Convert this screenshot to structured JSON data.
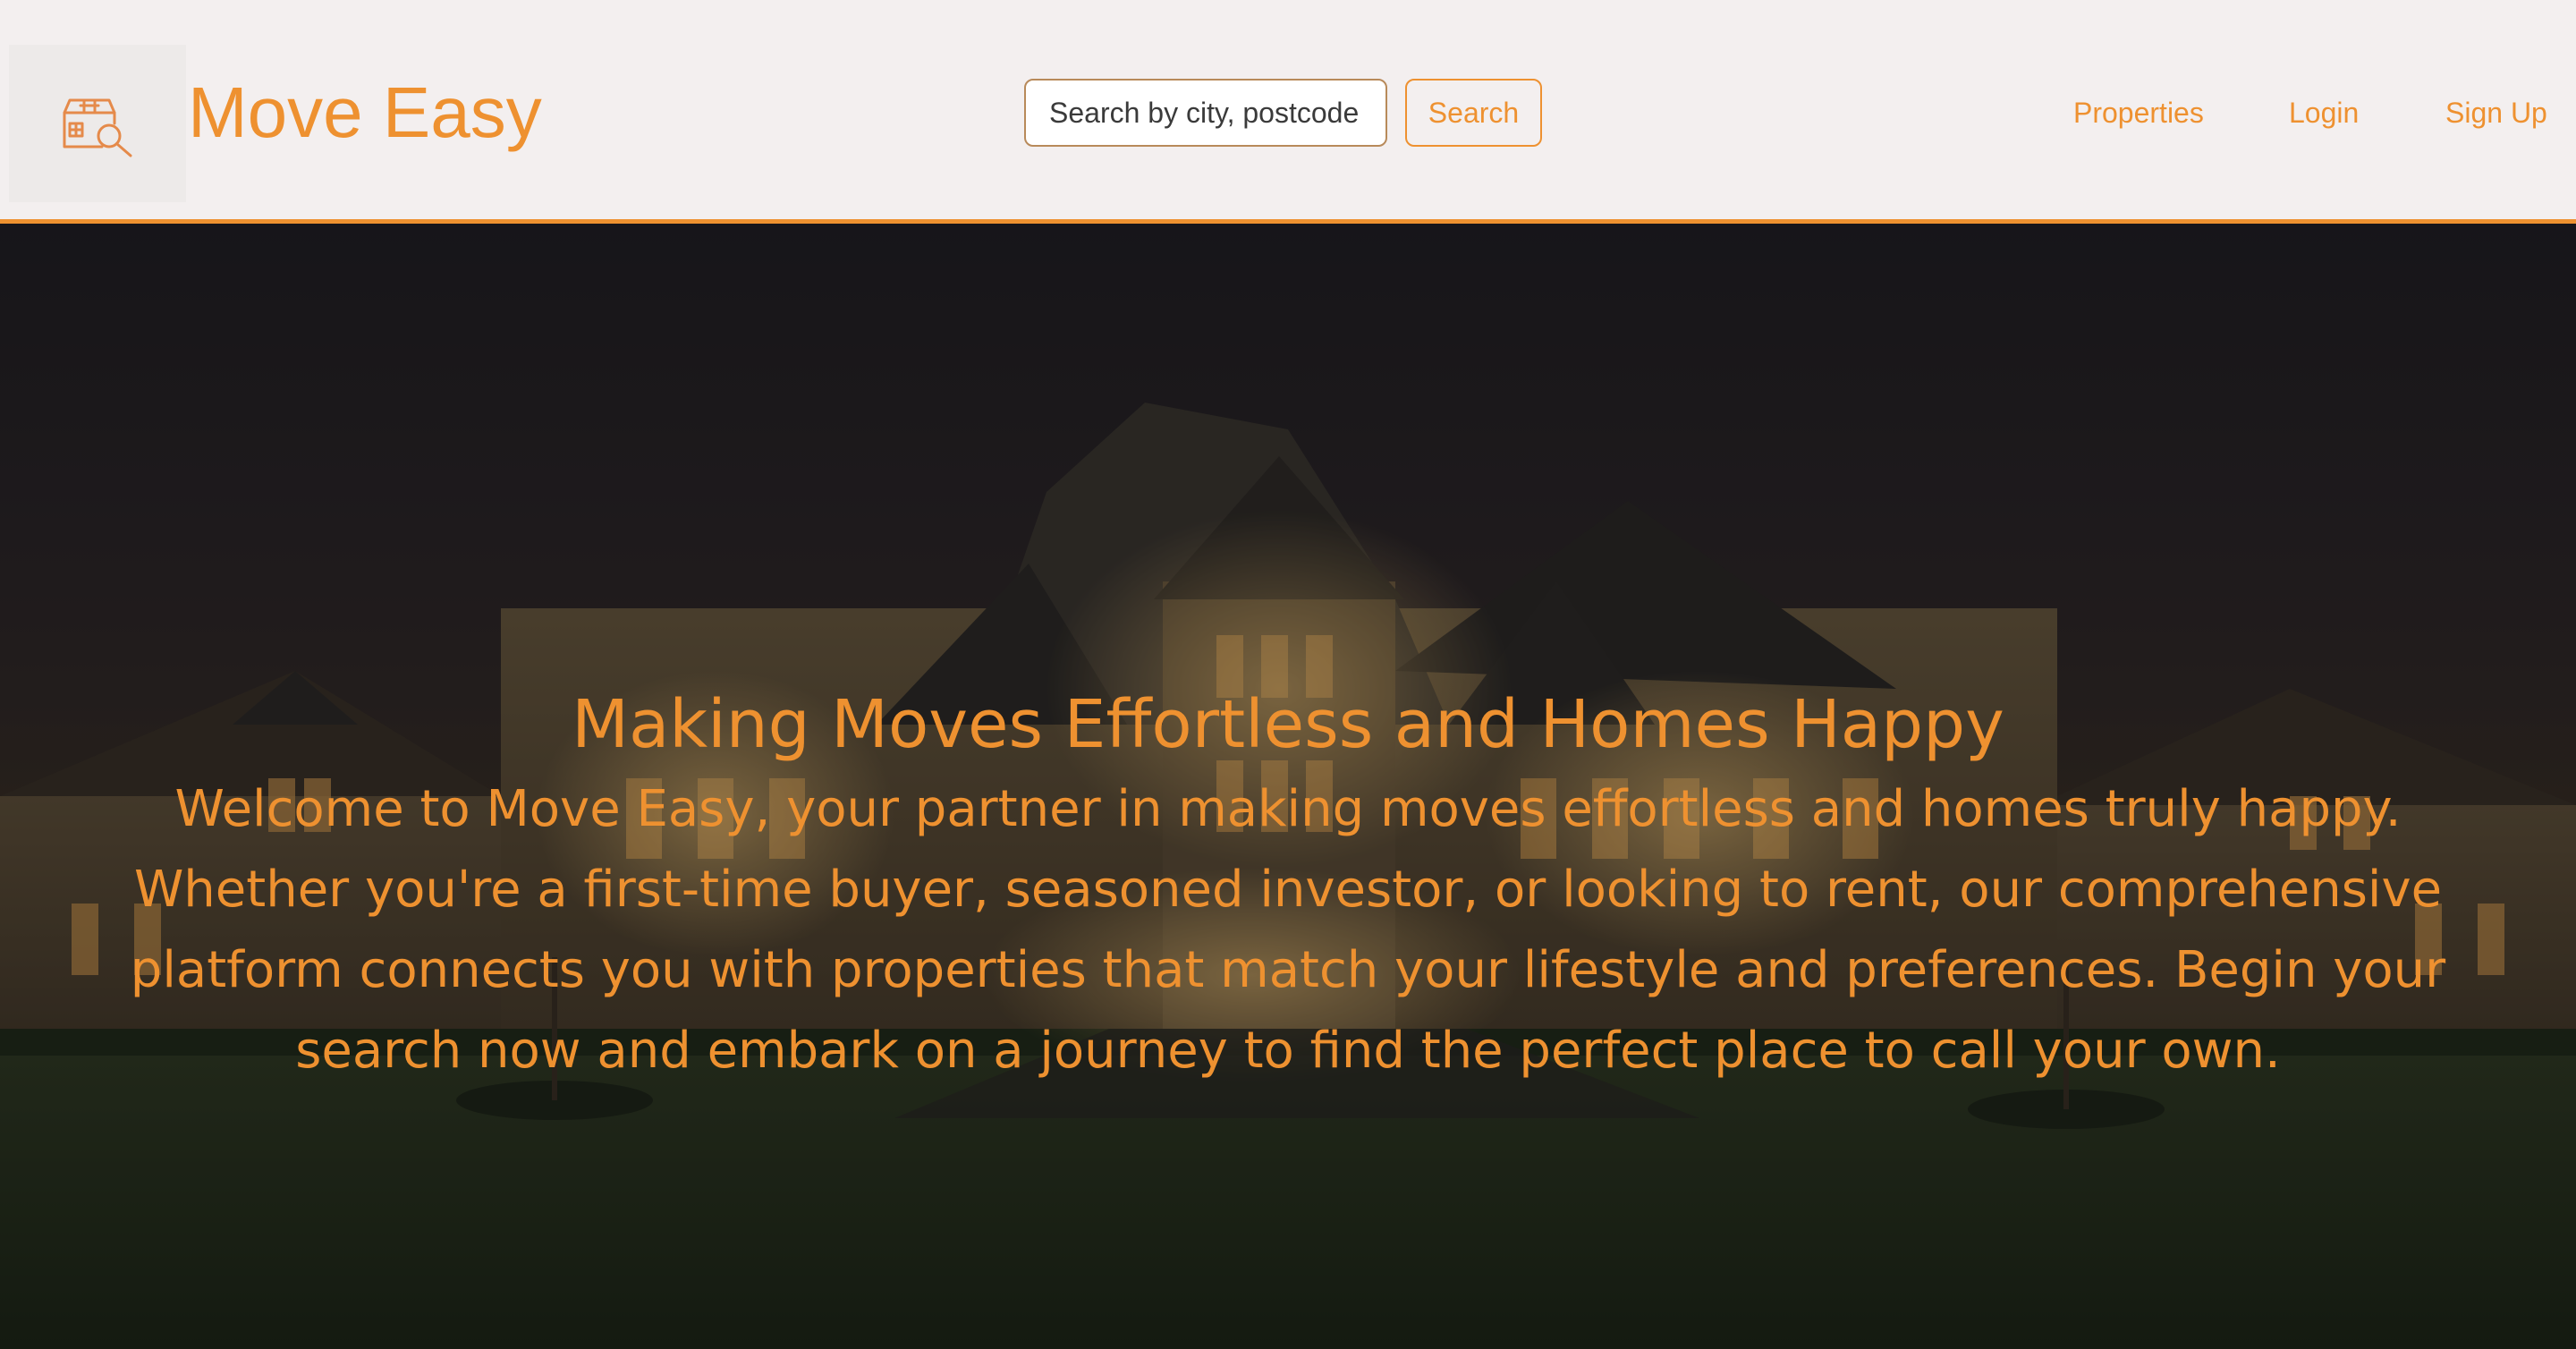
{
  "header": {
    "brand_name": "Move Easy",
    "logo_icon": "house-search-icon",
    "search": {
      "placeholder": "Search by city, postcode",
      "value": "",
      "button_label": "Search"
    },
    "nav": {
      "properties": "Properties",
      "login": "Login",
      "signup": "Sign Up"
    }
  },
  "hero": {
    "title": "Making Moves Effortless and Homes Happy",
    "description": "Welcome to Move Easy, your partner in making moves effortless and homes truly happy. Whether you're a first-time buyer, seasoned investor, or looking to rent, our comprehensive platform connects you with properties that match your lifestyle and preferences. Begin your search now and embark on a journey to find the perfect place to call your own."
  },
  "colors": {
    "accent": "#ee9130",
    "header_bg": "#f3efef"
  }
}
